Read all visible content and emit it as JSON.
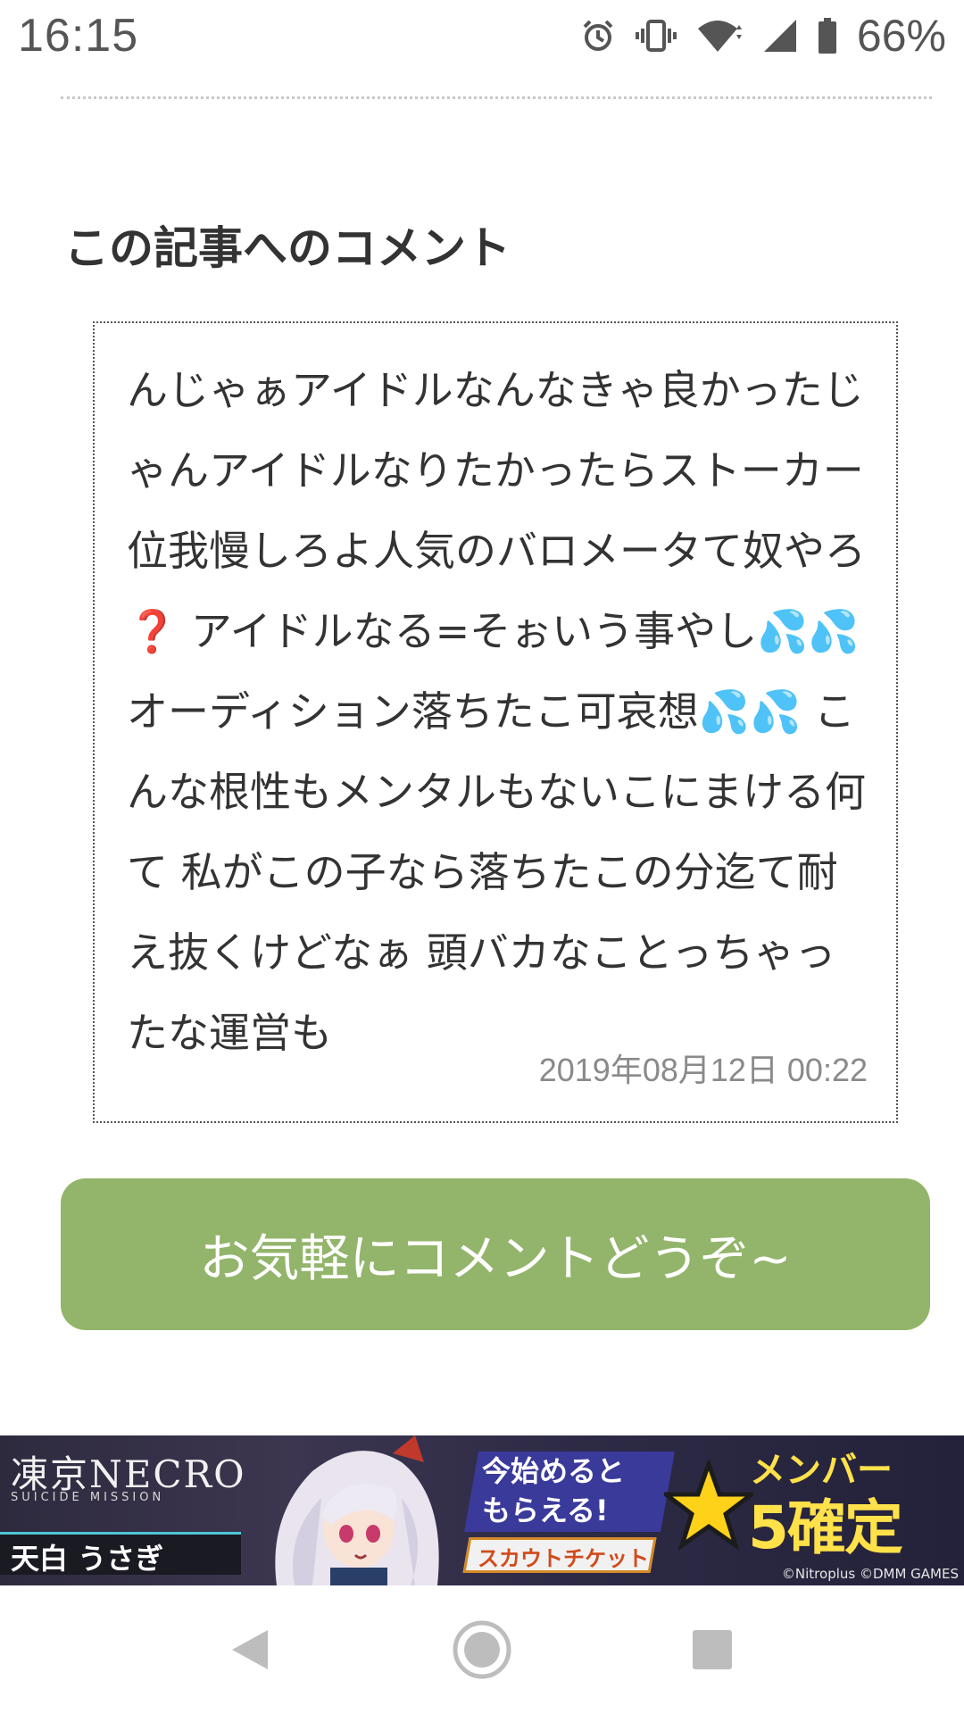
{
  "status_bar": {
    "time": "16:15",
    "battery": "66%"
  },
  "comments_section": {
    "title": "この記事へのコメント",
    "comment": {
      "lines": [
        "んじゃぁアイドルなんなきゃ良かった",
        "じゃんアイドルなりたかったらストー",
        "カー位我慢しろよ人気のバロメータて",
        "奴やろ",
        "❓",
        " アイドルなる=そぉいう事や",
        "し",
        "💦💦",
        " オーディション落ちたこ可哀",
        "想",
        "💦💦",
        " こんな根性もメンタルもない",
        "こにまける何て 私がこの子なら落ちた",
        "この分迄て耐え抜くけどなぁ 頭バカな",
        "ことっちゃったな運営も"
      ],
      "date": "2019年08月12日 00:22"
    },
    "comment_button_label": "お気軽にコメントどうぞ~"
  },
  "ad": {
    "logo": "凍京NECRO",
    "subtitle": "SUICIDE MISSION",
    "character_name": "天白 うさぎ",
    "promo_text_1": "今始めると",
    "promo_text_2": "もらえる!",
    "ticket_label": "スカウトチケット",
    "star_label": "メンバー",
    "confirm_label": "5確定",
    "copyright": "©Nitroplus ©DMM GAMES"
  },
  "colors": {
    "button_bg": "#93b56b",
    "text": "#333333",
    "date": "#8a8a8a"
  },
  "icons": {
    "alarm": "alarm-icon",
    "vibrate": "vibrate-icon",
    "wifi": "wifi-icon",
    "signal": "signal-icon",
    "battery": "battery-icon",
    "back": "back-icon",
    "home": "home-icon",
    "recents": "recents-icon"
  }
}
